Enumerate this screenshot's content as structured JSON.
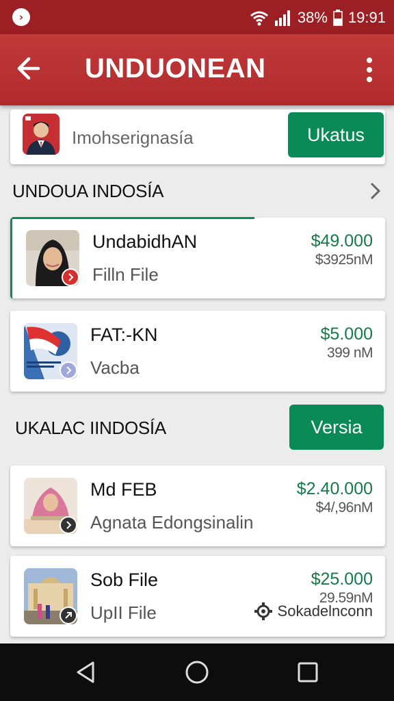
{
  "status_bar": {
    "battery_percent": "38%",
    "time": "19:91"
  },
  "app_bar": {
    "title": "UNDUONEAN"
  },
  "search": {
    "placeholder": "Imohserignasía",
    "button_label": "Ukatus"
  },
  "sections": [
    {
      "title": "UNDOUA INDOSÍA",
      "items": [
        {
          "name": "UndabidhAN",
          "subtitle": "Filln File",
          "price": "$49.000",
          "old_price": "$3925nM",
          "badge_color": "#d32f2f",
          "progress_percent": 65
        },
        {
          "name": "FAT:-KN",
          "subtitle": "Vacba",
          "price": "$5.000",
          "old_price": "399 nM",
          "badge_color": "#9fa8da"
        }
      ]
    },
    {
      "title": "UKALAC IINDOSÍA",
      "button_label": "Versia",
      "items": [
        {
          "name": "Md FEB",
          "subtitle": "Agnata Edongsinalin",
          "price": "$2.40.000",
          "old_price": "$4/,96nM",
          "badge_color": "#333333"
        },
        {
          "name": "Sob File",
          "subtitle": "UpII File",
          "price": "$25.000",
          "old_price": "29.59nM",
          "extra_label": "Sokadelnconn",
          "badge_color": "#333333"
        }
      ]
    }
  ],
  "colors": {
    "status_bar": "#9c1f23",
    "app_bar": "#b52f31",
    "accent_green": "#0a8a57",
    "price_green": "#157a4a"
  },
  "icons": [
    "app-notification-icon",
    "wifi-icon",
    "signal-icon",
    "battery-icon",
    "back-arrow-icon",
    "more-vert-icon",
    "chevron-right-icon",
    "gear-icon",
    "nav-back-icon",
    "nav-home-icon",
    "nav-recents-icon"
  ]
}
